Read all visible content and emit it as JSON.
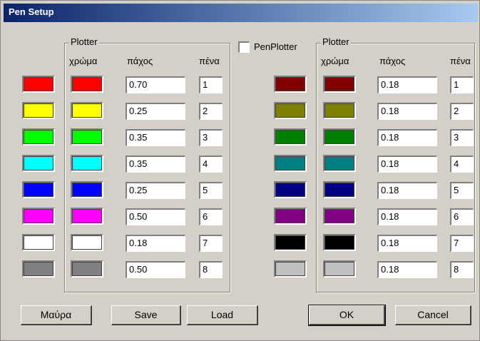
{
  "window": {
    "title": "Pen Setup"
  },
  "left_group": {
    "label": "Plotter",
    "headers": {
      "color": "χρώμα",
      "thickness": "πάχος",
      "pen": "πένα"
    },
    "rows": [
      {
        "screen_color": "#ff0000",
        "plotter_color": "#ff0000",
        "thickness": "0.70",
        "pen": "1"
      },
      {
        "screen_color": "#ffff00",
        "plotter_color": "#ffff00",
        "thickness": "0.25",
        "pen": "2"
      },
      {
        "screen_color": "#00ff00",
        "plotter_color": "#00ff00",
        "thickness": "0.35",
        "pen": "3"
      },
      {
        "screen_color": "#00ffff",
        "plotter_color": "#00ffff",
        "thickness": "0.35",
        "pen": "4"
      },
      {
        "screen_color": "#0000ff",
        "plotter_color": "#0000ff",
        "thickness": "0.25",
        "pen": "5"
      },
      {
        "screen_color": "#ff00ff",
        "plotter_color": "#ff00ff",
        "thickness": "0.50",
        "pen": "6"
      },
      {
        "screen_color": "#ffffff",
        "plotter_color": "#ffffff",
        "thickness": "0.18",
        "pen": "7"
      },
      {
        "screen_color": "#808080",
        "plotter_color": "#808080",
        "thickness": "0.50",
        "pen": "8"
      }
    ]
  },
  "penplotter": {
    "label": "PenPlotter",
    "checked": false
  },
  "right_group": {
    "label": "Plotter",
    "headers": {
      "color": "χρώμα",
      "thickness": "πάχος",
      "pen": "πένα"
    },
    "rows": [
      {
        "screen_color": "#800000",
        "plotter_color": "#800000",
        "thickness": "0.18",
        "pen": "1"
      },
      {
        "screen_color": "#808000",
        "plotter_color": "#808000",
        "thickness": "0.18",
        "pen": "2"
      },
      {
        "screen_color": "#008000",
        "plotter_color": "#008000",
        "thickness": "0.18",
        "pen": "3"
      },
      {
        "screen_color": "#008080",
        "plotter_color": "#008080",
        "thickness": "0.18",
        "pen": "4"
      },
      {
        "screen_color": "#000080",
        "plotter_color": "#000080",
        "thickness": "0.18",
        "pen": "5"
      },
      {
        "screen_color": "#800080",
        "plotter_color": "#800080",
        "thickness": "0.18",
        "pen": "6"
      },
      {
        "screen_color": "#000000",
        "plotter_color": "#000000",
        "thickness": "0.18",
        "pen": "7"
      },
      {
        "screen_color": "#c0c0c0",
        "plotter_color": "#c0c0c0",
        "thickness": "0.18",
        "pen": "8"
      }
    ]
  },
  "buttons": {
    "black": "Μαύρα",
    "save": "Save",
    "load": "Load",
    "ok": "OK",
    "cancel": "Cancel"
  }
}
